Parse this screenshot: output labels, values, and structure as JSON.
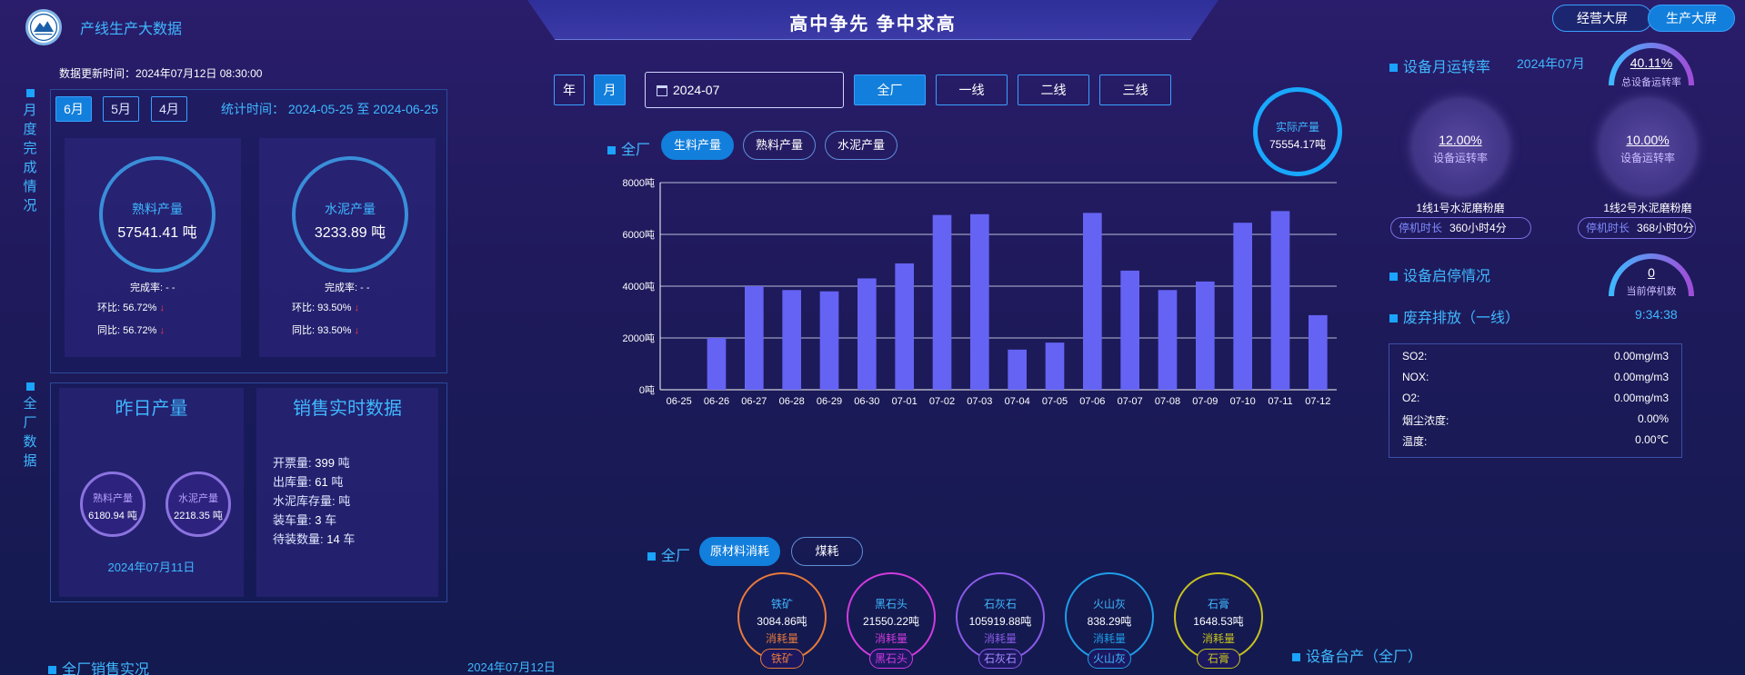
{
  "header": {
    "system_title": "产线生产大数据",
    "slogan": "高中争先 争中求高",
    "buttons": [
      "经营大屏",
      "生产大屏"
    ],
    "update_label": "数据更新时间：",
    "update_time": "2024年07月12日 08:30:00"
  },
  "monthly": {
    "side_label": "月度完成情况",
    "months": [
      "6月",
      "5月",
      "4月"
    ],
    "active_month": "6月",
    "stat_label": "统计时间：",
    "stat_range": "2024-05-25 至 2024-06-25",
    "cards": [
      {
        "name": "熟料产量",
        "value": "57541.41 吨",
        "completion_label": "完成率:",
        "completion": "- -",
        "mom_label": "环比:",
        "mom": "56.72%",
        "yoy_label": "同比:",
        "yoy": "56.72%"
      },
      {
        "name": "水泥产量",
        "value": "3233.89 吨",
        "completion_label": "完成率:",
        "completion": "- -",
        "mom_label": "环比:",
        "mom": "93.50%",
        "yoy_label": "同比:",
        "yoy": "93.50%"
      }
    ]
  },
  "plant": {
    "side_label": "全厂数据",
    "yesterday": {
      "title": "昨日产量",
      "items": [
        {
          "name": "熟料产量",
          "value": "6180.94 吨"
        },
        {
          "name": "水泥产量",
          "value": "2218.35 吨"
        }
      ],
      "date": "2024年07月11日"
    },
    "sales": {
      "title": "销售实时数据",
      "rows": [
        {
          "label": "开票量:",
          "value": "399",
          "unit": "吨"
        },
        {
          "label": "出库量:",
          "value": "61",
          "unit": "吨"
        },
        {
          "label": "水泥库存量:",
          "value": "",
          "unit": "吨"
        },
        {
          "label": "装车量:",
          "value": "3",
          "unit": "车"
        },
        {
          "label": "待装数量:",
          "value": "14",
          "unit": "车"
        }
      ]
    }
  },
  "bottom_left": {
    "title": "全厂销售实况",
    "date": "2024年07月12日"
  },
  "controls": {
    "period": [
      "年",
      "月"
    ],
    "active_period": "月",
    "date_value": "2024-07",
    "lines": [
      "全厂",
      "一线",
      "二线",
      "三线"
    ],
    "active_line": "全厂"
  },
  "production": {
    "scope": "全厂",
    "tabs": [
      "生料产量",
      "熟料产量",
      "水泥产量"
    ],
    "active_tab": "生料产量",
    "actual_label": "实际产量",
    "actual_value": "75554.17吨"
  },
  "chart_data": {
    "type": "bar",
    "categories": [
      "06-25",
      "06-26",
      "06-27",
      "06-28",
      "06-29",
      "06-30",
      "07-01",
      "07-02",
      "07-03",
      "07-04",
      "07-05",
      "07-06",
      "07-07",
      "07-08",
      "07-09",
      "07-10",
      "07-11",
      "07-12"
    ],
    "values": [
      0,
      2000,
      4000,
      3850,
      3800,
      4300,
      4880,
      6750,
      6780,
      1550,
      1820,
      6830,
      4600,
      3850,
      4180,
      6450,
      6900,
      2880
    ],
    "y_ticks": [
      "0吨",
      "2000吨",
      "4000吨",
      "6000吨",
      "8000吨"
    ],
    "ylim": [
      0,
      8000
    ],
    "grid": true,
    "bar_color": "#6563f3"
  },
  "consumption": {
    "scope": "全厂",
    "tabs": [
      "原材料消耗",
      "煤耗"
    ],
    "active_tab": "原材料消耗",
    "unit_label": "消耗量",
    "materials": [
      {
        "name": "铁矿",
        "value": "3084.86吨",
        "color": "#e87a3a"
      },
      {
        "name": "黑石头",
        "value": "21550.22吨",
        "color": "#d13adf"
      },
      {
        "name": "石灰石",
        "value": "105919.88吨",
        "color": "#8a5ae8"
      },
      {
        "name": "火山灰",
        "value": "838.29吨",
        "color": "#1f9de8"
      },
      {
        "name": "石膏",
        "value": "1648.53吨",
        "color": "#c7c21f"
      }
    ]
  },
  "equipment": {
    "title": "设备月运转率",
    "month": "2024年07月",
    "total_value": "40.11%",
    "total_label": "总设备运转率",
    "total_fraction": 0.4011,
    "mills": [
      {
        "value": "12.00%",
        "label": "设备运转率",
        "name": "1线1号水泥磨粉磨",
        "stop_label": "停机时长",
        "stop_value": "360小时4分"
      },
      {
        "value": "10.00%",
        "label": "设备运转率",
        "name": "1线2号水泥磨粉磨",
        "stop_label": "停机时长",
        "stop_value": "368小时0分"
      }
    ],
    "start_stop_title": "设备启停情况",
    "stopped_count": "0",
    "stopped_label": "当前停机数",
    "emission_title": "废弃排放（一线）",
    "emission_time": "9:34:38",
    "emissions": [
      {
        "label": "SO2:",
        "value": "0.00mg/m3"
      },
      {
        "label": "NOX:",
        "value": "0.00mg/m3"
      },
      {
        "label": "O2:",
        "value": "0.00mg/m3"
      },
      {
        "label": "烟尘浓度:",
        "value": "0.00%"
      },
      {
        "label": "温度:",
        "value": "0.00℃"
      }
    ],
    "ledger_title": "设备台产（全厂）"
  }
}
